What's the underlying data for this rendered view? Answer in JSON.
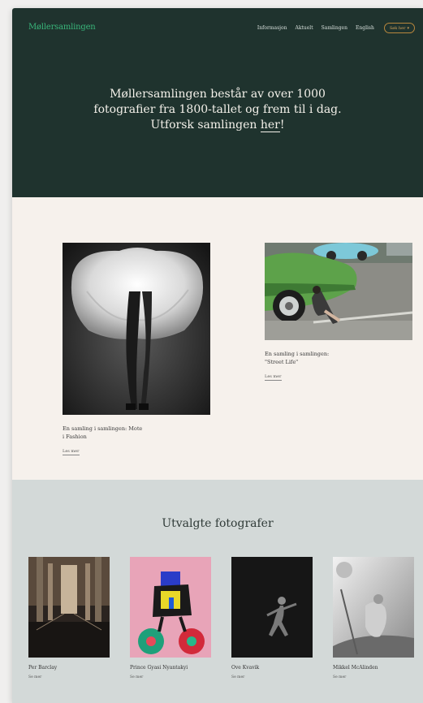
{
  "header": {
    "logo": "Møllersamlingen",
    "nav": [
      "Informasjon",
      "Aktuelt",
      "Samlingen",
      "English"
    ],
    "search_label": "Søk her"
  },
  "hero": {
    "line1": "Møllersamlingen består av over 1000",
    "line2": "fotografier fra 1800-tallet og frem til i dag.",
    "line3_prefix": "Utforsk samlingen ",
    "line3_link": "her",
    "line3_suffix": "!"
  },
  "collections": [
    {
      "caption_line1": "En samling i samlingen: Mote",
      "caption_line2": "i Fashion",
      "read_more": "Les mer"
    },
    {
      "caption_line1": "En samling i samlingen:",
      "caption_line2": "\"Street Life\"",
      "read_more": "Les mer"
    }
  ],
  "photographers_section": {
    "title": "Utvalgte fotografer",
    "items": [
      {
        "name": "Per Barclay",
        "more": "Se mer"
      },
      {
        "name": "Prince Gyasi Nyantakyi",
        "more": "Se mer"
      },
      {
        "name": "Ove Kvavik",
        "more": "Se mer"
      },
      {
        "name": "Mikkel McAlinden",
        "more": "Se mer"
      }
    ]
  },
  "colors": {
    "hero_bg": "#1f332e",
    "logo_green": "#39b57a",
    "accent_gold": "#b8873d",
    "cream_bg": "#f6f1ec",
    "gray_section_bg": "#d3d9d8"
  },
  "icons": {
    "search_chevron": "chevron-down-icon"
  }
}
